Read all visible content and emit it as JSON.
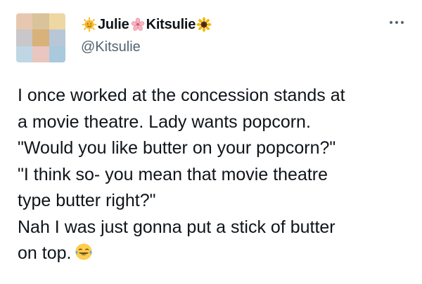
{
  "tweet": {
    "author": {
      "name_part1": "Julie",
      "name_part2": "Kitsulie",
      "handle": "@Kitsulie",
      "avatar_colors": [
        "#e8c7b0",
        "#d9c39a",
        "#efd7a3",
        "#c9c7c9",
        "#d8b27a",
        "#b7c7d8",
        "#c0d6e4",
        "#e9c6bf",
        "#a9c9dc"
      ]
    },
    "body_lines": [
      "I once worked at the concession stands at",
      "a movie theatre. Lady wants popcorn.",
      "\"Would you like butter on your popcorn?\"",
      "\"I think so- you mean that movie theatre",
      "type butter right?\"",
      "Nah I was just gonna put a stick of butter",
      "on top."
    ],
    "icons": {
      "sun_emoji": "sun-with-face-icon",
      "flower_emoji": "cherry-blossom-icon",
      "sunflower_emoji": "sunflower-icon",
      "laugh_emoji": "face-with-tears-of-joy-icon",
      "more": "more-options-icon"
    }
  }
}
